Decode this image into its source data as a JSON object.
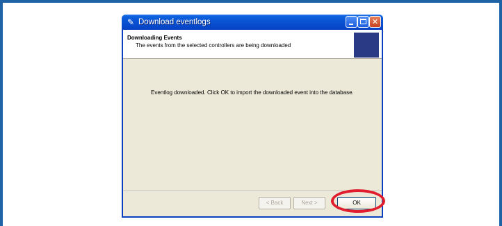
{
  "window": {
    "title": "Download eventlogs",
    "icon": "wrench-app-icon"
  },
  "header": {
    "title": "Downloading Events",
    "subtitle": "The events from the selected controllers are being downloaded"
  },
  "content": {
    "message": "Eventlog downloaded.  Click OK to import the downloaded event into the database."
  },
  "buttons": {
    "back": "< Back",
    "next": "Next >",
    "ok": "OK"
  },
  "colors": {
    "frame_border": "#1f62a6",
    "highlight": "#e01e2e",
    "titlebar": "#0a54d6",
    "header_image": "#2a3a85"
  }
}
